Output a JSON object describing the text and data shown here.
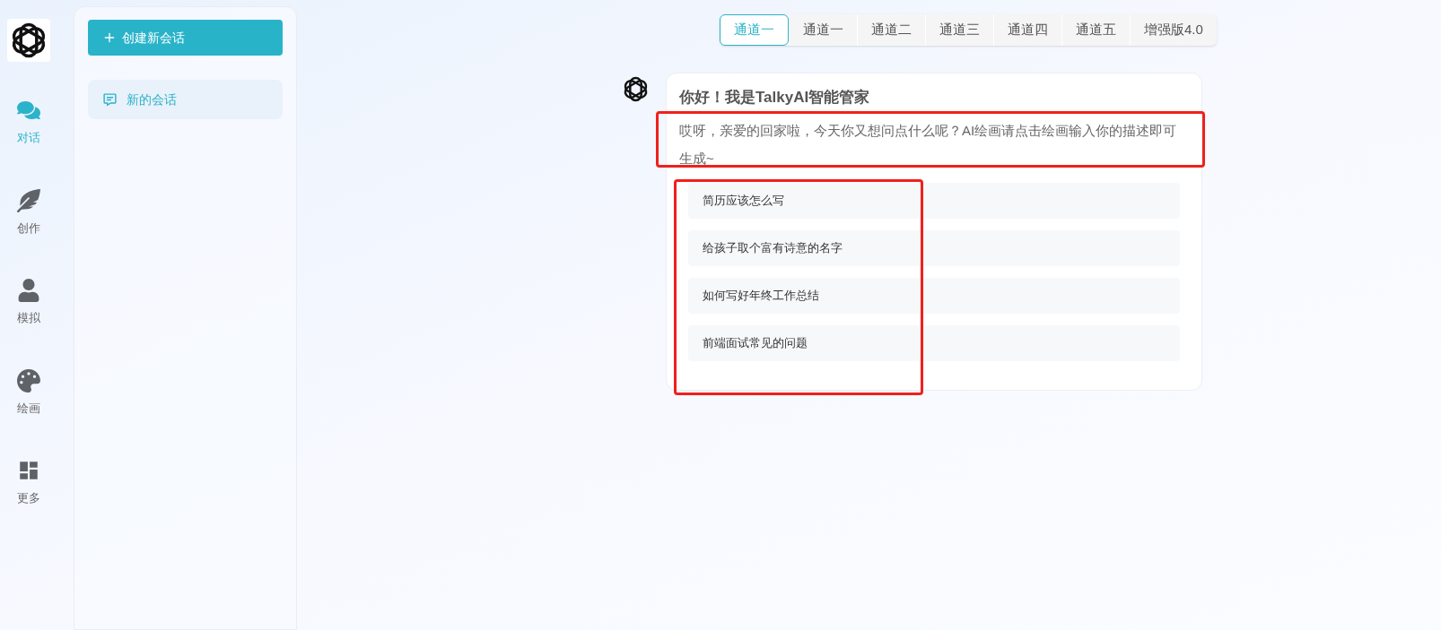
{
  "nav": [
    {
      "label": "对话",
      "kind": "chat",
      "selected": true
    },
    {
      "label": "创作",
      "kind": "feather",
      "selected": false
    },
    {
      "label": "模拟",
      "kind": "person",
      "selected": false
    },
    {
      "label": "绘画",
      "kind": "palette",
      "selected": false
    },
    {
      "label": "更多",
      "kind": "grid",
      "selected": false
    }
  ],
  "new_chat_button": "创建新会话",
  "conversations": [
    {
      "title": "新的会话",
      "selected": true
    }
  ],
  "channels": [
    {
      "label": "通道一",
      "selected": true
    },
    {
      "label": "通道一",
      "selected": false
    },
    {
      "label": "通道二",
      "selected": false
    },
    {
      "label": "通道三",
      "selected": false
    },
    {
      "label": "通道四",
      "selected": false
    },
    {
      "label": "通道五",
      "selected": false
    },
    {
      "label": "增强版4.0",
      "selected": false
    }
  ],
  "greeting": {
    "title": "你好！我是TalkyAI智能管家",
    "message": "哎呀，亲爱的回家啦，今天你又想问点什么呢？AI绘画请点击绘画输入你的描述即可生成~",
    "highlighted": true
  },
  "suggestions": {
    "highlighted": true,
    "items": [
      "简历应该怎么写",
      "给孩子取个富有诗意的名字",
      "如何写好年终工作总结",
      "前端面试常见的问题"
    ]
  }
}
